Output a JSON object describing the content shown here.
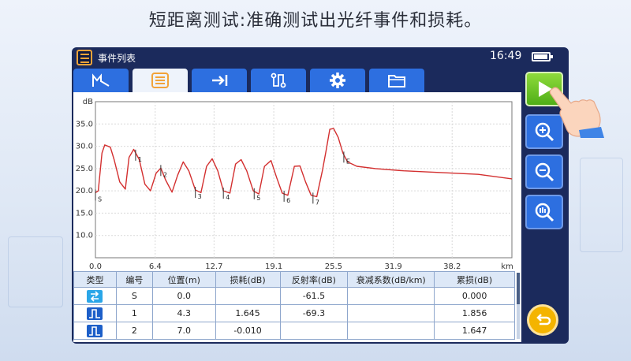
{
  "headline": "短距离测试:准确测试出光纤事件和损耗。",
  "app": {
    "title": "事件列表",
    "clock": "16:49"
  },
  "tabs": [
    {
      "icon": "trace-icon",
      "active": false
    },
    {
      "icon": "event-list-icon",
      "active": true
    },
    {
      "icon": "arrow-to-bar-icon",
      "active": false
    },
    {
      "icon": "route-icon",
      "active": false
    },
    {
      "icon": "gear-icon",
      "active": false
    },
    {
      "icon": "folder-icon",
      "active": false
    }
  ],
  "chart_data": {
    "type": "line",
    "title": "",
    "xlabel": "",
    "ylabel": "dB",
    "x_unit": "km",
    "xlim": [
      0.0,
      44.6
    ],
    "ylim": [
      5.0,
      40.0
    ],
    "x_ticks": [
      "0.0",
      "6.4",
      "12.7",
      "19.1",
      "25.5",
      "31.9",
      "38.2"
    ],
    "y_ticks": [
      "35.0",
      "30.0",
      "25.0",
      "20.0",
      "15.0",
      "10.0"
    ],
    "grid": true,
    "series": [
      {
        "color": "#d32f2f",
        "x": [
          0.0,
          0.3,
          0.7,
          1.0,
          1.6,
          2.0,
          2.6,
          3.2,
          3.6,
          4.1,
          4.7,
          5.3,
          5.9,
          6.5,
          7.0,
          7.5,
          8.2,
          8.8,
          9.4,
          10.0,
          10.7,
          11.3,
          11.9,
          12.5,
          13.1,
          13.7,
          14.4,
          15.0,
          15.6,
          16.2,
          16.9,
          17.5,
          18.1,
          18.8,
          19.4,
          20.0,
          20.6,
          21.3,
          21.9,
          22.5,
          23.1,
          23.7,
          24.3,
          24.7,
          25.1,
          25.5,
          26.0,
          26.5,
          27.0,
          28.0,
          30.0,
          33.0,
          37.0,
          41.0,
          44.6
        ],
        "y": [
          19.6,
          20.0,
          28.5,
          30.3,
          29.8,
          27.0,
          22.0,
          20.4,
          27.5,
          29.3,
          27.0,
          21.5,
          20.0,
          24.0,
          25.1,
          22.5,
          19.7,
          23.5,
          26.5,
          24.5,
          20.2,
          19.6,
          25.5,
          27.2,
          24.5,
          20.0,
          19.5,
          26.0,
          27.0,
          24.5,
          20.0,
          19.3,
          25.5,
          26.8,
          23.0,
          19.5,
          19.0,
          25.5,
          25.6,
          22.0,
          19.0,
          18.7,
          24.5,
          29.0,
          33.8,
          34.0,
          32.0,
          28.5,
          26.5,
          25.5,
          25.0,
          24.5,
          24.1,
          23.7,
          22.7
        ]
      }
    ],
    "markers": [
      {
        "label": "S",
        "x": 0.0
      },
      {
        "label": "1",
        "x": 4.3
      },
      {
        "label": "2",
        "x": 7.0
      },
      {
        "label": "3",
        "x": 10.7
      },
      {
        "label": "4",
        "x": 13.7
      },
      {
        "label": "5",
        "x": 17.0
      },
      {
        "label": "6",
        "x": 20.2
      },
      {
        "label": "7",
        "x": 23.3
      },
      {
        "label": "E",
        "x": 26.6
      }
    ]
  },
  "table": {
    "headers": [
      "类型",
      "编号",
      "位置(m)",
      "损耗(dB)",
      "反射率(dB)",
      "衰减系数(dB/km)",
      "累损(dB)"
    ],
    "rows": [
      {
        "type_icon": "start-event-icon",
        "type_color": "#2aa6e8",
        "cells": [
          "S",
          "0.0",
          "",
          "-61.5",
          "",
          "0.000"
        ]
      },
      {
        "type_icon": "reflect-event-icon",
        "type_color": "#1d5fc9",
        "cells": [
          "1",
          "4.3",
          "1.645",
          "-69.3",
          "",
          "1.856"
        ]
      },
      {
        "type_icon": "reflect-event-icon",
        "type_color": "#1d5fc9",
        "cells": [
          "2",
          "7.0",
          "-0.010",
          "",
          "",
          "1.647"
        ]
      }
    ]
  },
  "side_buttons": [
    {
      "icon": "play-icon",
      "color": "#5cb521"
    },
    {
      "icon": "zoom-in-icon"
    },
    {
      "icon": "zoom-out-icon"
    },
    {
      "icon": "zoom-fit-icon"
    }
  ],
  "back_button": {
    "icon": "back-icon",
    "color": "#f4b400"
  }
}
